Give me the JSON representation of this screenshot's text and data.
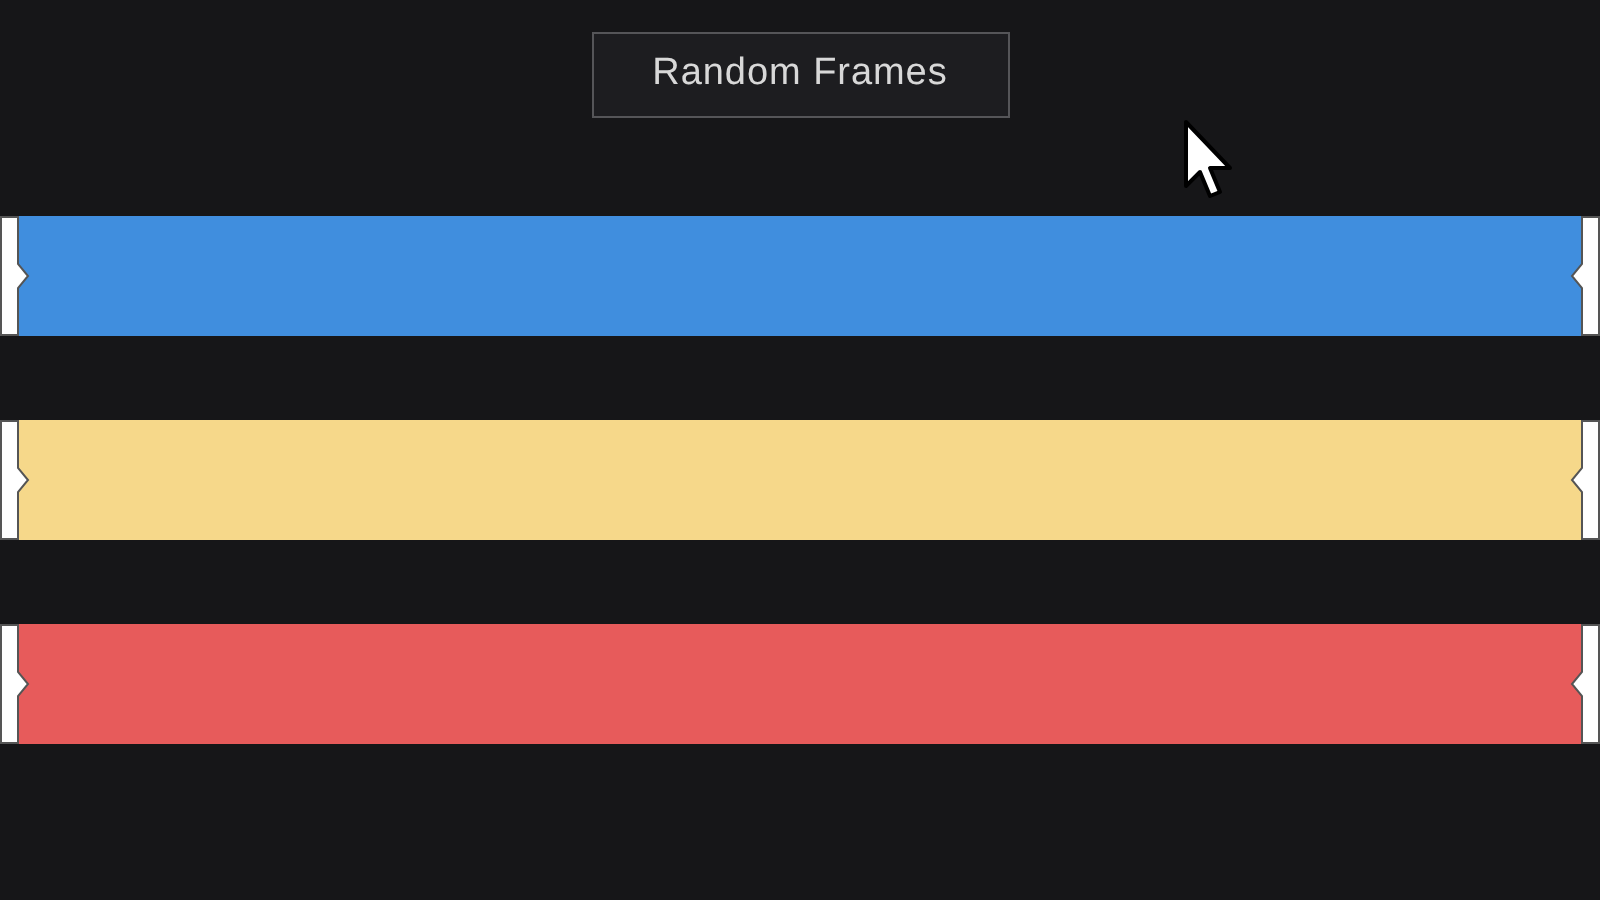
{
  "button": {
    "label": "Random Frames"
  },
  "clips": [
    {
      "color": "#408ede"
    },
    {
      "color": "#f6d88a"
    },
    {
      "color": "#e75b5b"
    }
  ]
}
